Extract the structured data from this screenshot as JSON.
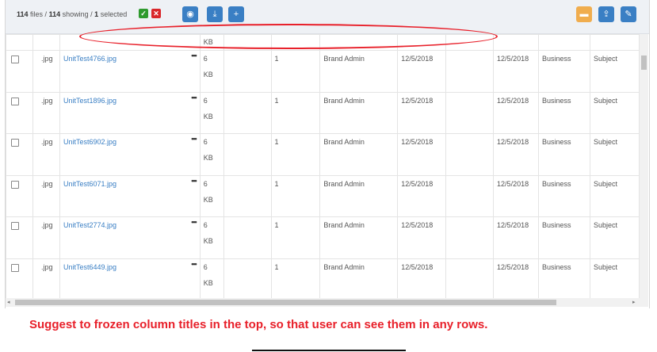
{
  "summary": {
    "files_total": "114",
    "files_label": "files /",
    "showing_count": "114",
    "showing_label": "showing /",
    "selected_count": "1",
    "selected_label": "selected"
  },
  "toolbar": {
    "view_icon": "eye-icon",
    "download_icon": "download-icon",
    "add_icon": "plus-icon",
    "folder_icon": "folder-icon",
    "share_icon": "user-upload-icon",
    "edit_icon": "pencil-icon"
  },
  "partial_row": {
    "size_unit": "KB"
  },
  "rows": [
    {
      "ext": ".jpg",
      "name": "UnitTest4766.jpg",
      "size": "6",
      "unit": "KB",
      "version": "1",
      "owner": "Brand Admin",
      "created": "12/5/2018",
      "modified": "12/5/2018",
      "category": "Business",
      "subject": "Subject"
    },
    {
      "ext": ".jpg",
      "name": "UnitTest1896.jpg",
      "size": "6",
      "unit": "KB",
      "version": "1",
      "owner": "Brand Admin",
      "created": "12/5/2018",
      "modified": "12/5/2018",
      "category": "Business",
      "subject": "Subject"
    },
    {
      "ext": ".jpg",
      "name": "UnitTest6902.jpg",
      "size": "6",
      "unit": "KB",
      "version": "1",
      "owner": "Brand Admin",
      "created": "12/5/2018",
      "modified": "12/5/2018",
      "category": "Business",
      "subject": "Subject"
    },
    {
      "ext": ".jpg",
      "name": "UnitTest6071.jpg",
      "size": "6",
      "unit": "KB",
      "version": "1",
      "owner": "Brand Admin",
      "created": "12/5/2018",
      "modified": "12/5/2018",
      "category": "Business",
      "subject": "Subject"
    },
    {
      "ext": ".jpg",
      "name": "UnitTest2774.jpg",
      "size": "6",
      "unit": "KB",
      "version": "1",
      "owner": "Brand Admin",
      "created": "12/5/2018",
      "modified": "12/5/2018",
      "category": "Business",
      "subject": "Subject"
    },
    {
      "ext": ".jpg",
      "name": "UnitTest6449.jpg",
      "size": "6",
      "unit": "KB",
      "version": "1",
      "owner": "Brand Admin",
      "created": "12/5/2018",
      "modified": "12/5/2018",
      "category": "Business",
      "subject": "Subject"
    }
  ],
  "annotation": {
    "note": "Suggest to  frozen  column titles in the top, so that user can see them in any rows."
  },
  "colors": {
    "accent": "#3a7fc4",
    "warning": "#f0ad4e",
    "annotation": "#e8202a"
  }
}
